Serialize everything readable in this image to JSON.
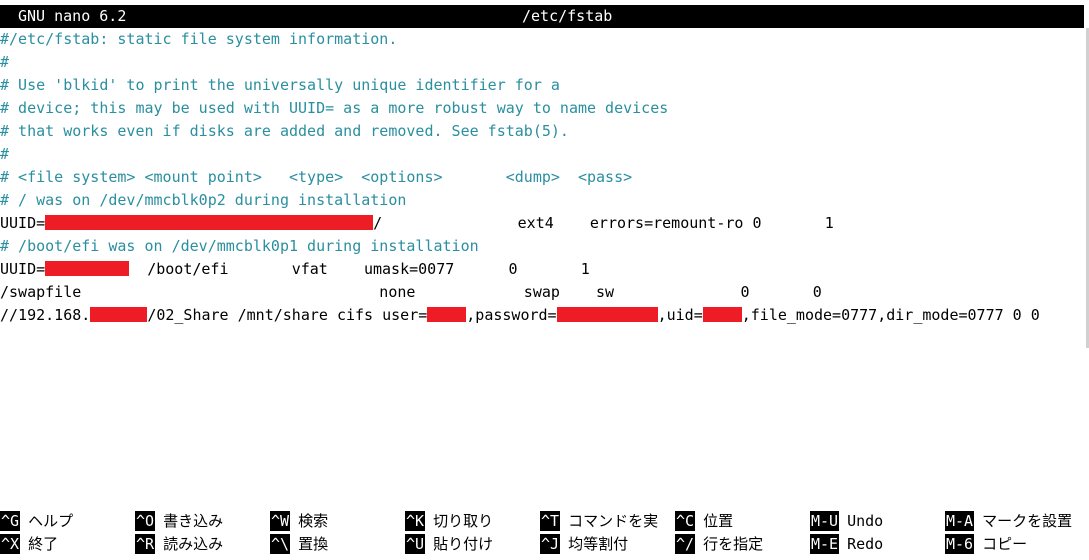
{
  "titlebar": {
    "app_version": "GNU nano 6.2",
    "filename": "/etc/fstab"
  },
  "file_lines": {
    "l01": "#/etc/fstab: static file system information.",
    "l02": "#",
    "l03": "# Use 'blkid' to print the universally unique identifier for a",
    "l04": "# device; this may be used with UUID= as a more robust way to name devices",
    "l05": "# that works even if disks are added and removed. See fstab(5).",
    "l06": "#",
    "l07": "# <file system> <mount point>   <type>  <options>       <dump>  <pass>",
    "l08": "# / was on /dev/mmcblk0p2 during installation",
    "l09_a": "UUID=",
    "l09_b": "/               ext4    errors=remount-ro 0       1",
    "l10": "# /boot/efi was on /dev/mmcblk0p1 during installation",
    "l11_a": "UUID=",
    "l11_b": "  /boot/efi       vfat    umask=0077      0       1",
    "l12": "/swapfile                                 none            swap    sw              0       0",
    "l13_a": "//192.168.",
    "l13_b": "/02_Share /mnt/share cifs user=",
    "l13_c": ",password=",
    "l13_d": ",uid=",
    "l13_e": ",file_mode=0777,dir_mode=0777 0 0"
  },
  "shortcuts": {
    "row1": [
      {
        "key": "^G",
        "label": "ヘルプ"
      },
      {
        "key": "^O",
        "label": "書き込み"
      },
      {
        "key": "^W",
        "label": "検索"
      },
      {
        "key": "^K",
        "label": "切り取り"
      },
      {
        "key": "^T",
        "label": "コマンドを実"
      },
      {
        "key": "^C",
        "label": "位置"
      },
      {
        "key": "M-U",
        "label": "Undo"
      },
      {
        "key": "M-A",
        "label": "マークを設置"
      }
    ],
    "row2": [
      {
        "key": "^X",
        "label": "終了"
      },
      {
        "key": "^R",
        "label": "読み込み"
      },
      {
        "key": "^\\",
        "label": "置換"
      },
      {
        "key": "^U",
        "label": "貼り付け"
      },
      {
        "key": "^J",
        "label": "均等割付"
      },
      {
        "key": "^/",
        "label": "行を指定"
      },
      {
        "key": "M-E",
        "label": "Redo"
      },
      {
        "key": "M-6",
        "label": "コピー"
      }
    ]
  },
  "colors": {
    "comment": "#2a8fa0",
    "redaction": "#ee1c25",
    "titlebar_bg": "#000000"
  }
}
